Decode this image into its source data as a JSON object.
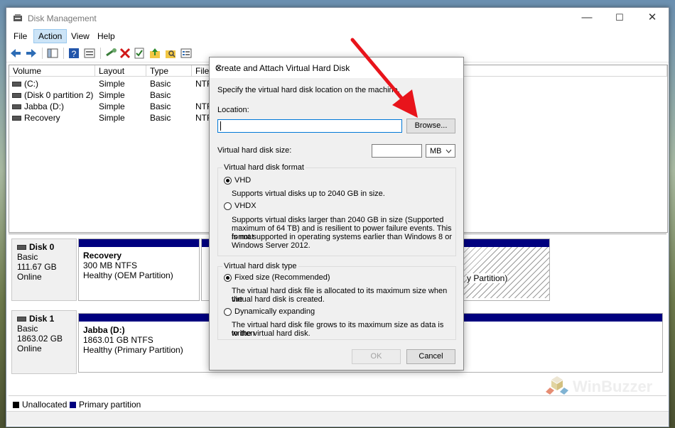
{
  "window": {
    "title": "Disk Management",
    "min": "—",
    "max": "☐",
    "close": "✕"
  },
  "menu": [
    "File",
    "Action",
    "View",
    "Help"
  ],
  "columns": [
    "Volume",
    "Layout",
    "Type",
    "File"
  ],
  "volumes": [
    {
      "name": "(C:)",
      "layout": "Simple",
      "type": "Basic",
      "fs": "NTF"
    },
    {
      "name": "(Disk 0 partition 2)",
      "layout": "Simple",
      "type": "Basic",
      "fs": ""
    },
    {
      "name": "Jabba (D:)",
      "layout": "Simple",
      "type": "Basic",
      "fs": "NTF"
    },
    {
      "name": "Recovery",
      "layout": "Simple",
      "type": "Basic",
      "fs": "NTF"
    }
  ],
  "disks": [
    {
      "name": "Disk 0",
      "kind": "Basic",
      "size": "111.67 GB",
      "status": "Online",
      "partitions": [
        {
          "name": "Recovery",
          "size": "300 MB NTFS",
          "status": "Healthy (OEM Partition)"
        },
        {
          "name": "",
          "size": "",
          "status": "y Partition)"
        }
      ]
    },
    {
      "name": "Disk 1",
      "kind": "Basic",
      "size": "1863.02 GB",
      "status": "Online",
      "partitions": [
        {
          "name": "Jabba  (D:)",
          "size": "1863.01 GB NTFS",
          "status": "Healthy (Primary Partition)"
        }
      ]
    }
  ],
  "legend": [
    {
      "label": "Unallocated",
      "color": "#000000"
    },
    {
      "label": "Primary partition",
      "color": "#00007f"
    }
  ],
  "dialog": {
    "title": "Create and Attach Virtual Hard Disk",
    "close": "✕",
    "intro": "Specify the virtual hard disk location on the machine.",
    "location_label": "Location:",
    "location_value": "",
    "browse": "Browse...",
    "size_label": "Virtual hard disk size:",
    "size_value": "",
    "unit": "MB",
    "format_group": "Virtual hard disk format",
    "vhd": "VHD",
    "vhd_desc": "Supports virtual disks up to 2040 GB in size.",
    "vhdx": "VHDX",
    "vhdx_desc_1": "Supports virtual disks larger than 2040 GB in size (Supported",
    "vhdx_desc_2": "maximum of 64 TB) and is resilient to power failure events. This format",
    "vhdx_desc_3": "is not supported in operating systems earlier than Windows 8 or",
    "vhdx_desc_4": "Windows Server 2012.",
    "type_group": "Virtual hard disk type",
    "fixed": "Fixed size (Recommended)",
    "fixed_desc_1": "The virtual hard disk file is allocated to its maximum size when the",
    "fixed_desc_2": "virtual hard disk is created.",
    "dynamic": "Dynamically expanding",
    "dynamic_desc_1": "The virtual hard disk file grows to its maximum size as data is written",
    "dynamic_desc_2": "to the virtual hard disk.",
    "ok": "OK",
    "cancel": "Cancel"
  },
  "watermark": "WinBuzzer",
  "colors": {
    "accent_arrow": "#e8141b",
    "partition_bar": "#00007f",
    "menu_active": "#cce4f7"
  }
}
